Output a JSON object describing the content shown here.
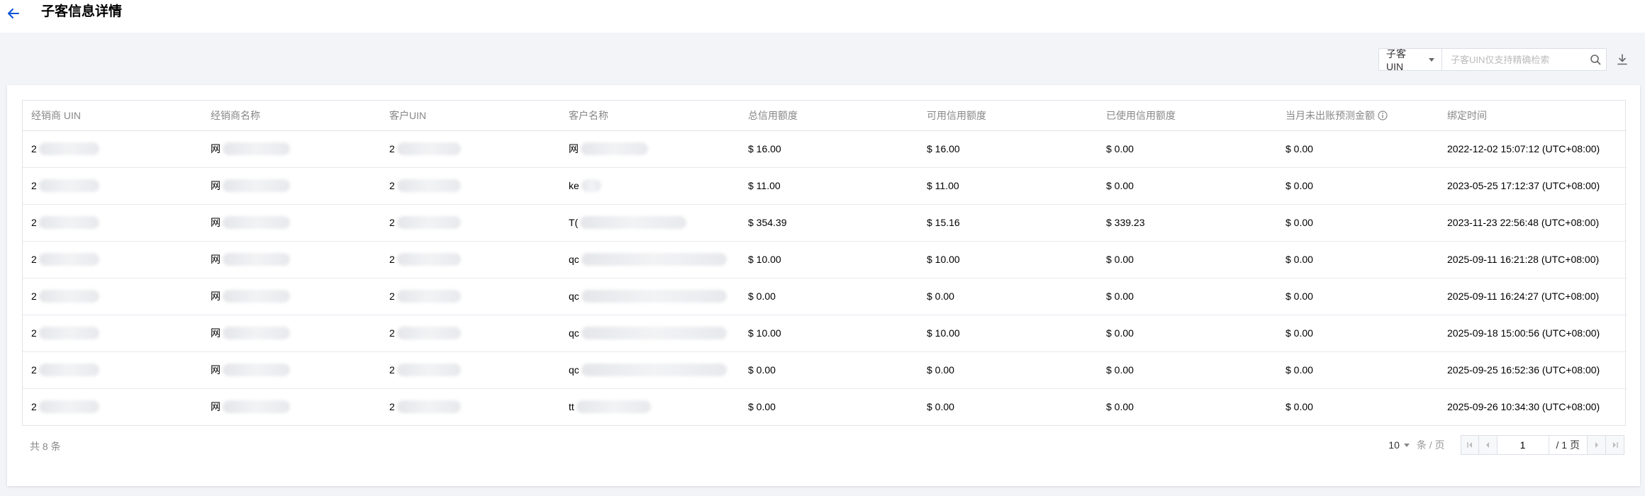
{
  "header": {
    "title": "子客信息详情",
    "back_icon": "arrow-left-icon",
    "accent": "#0052d9"
  },
  "toolbar": {
    "filter_label": "子客 UIN",
    "search_placeholder": "子客UIN仅支持精确检索",
    "search_icon": "search-icon",
    "download_icon": "download-icon"
  },
  "table": {
    "columns": [
      "经销商 UIN",
      "经销商名称",
      "客户UIN",
      "客户名称",
      "总信用额度",
      "可用信用额度",
      "已使用信用额度",
      "当月未出账预测金额",
      "绑定时间"
    ],
    "rows": [
      {
        "dealer_uin": "2",
        "dealer_name": "网",
        "customer_uin": "2",
        "customer_name": "网",
        "total_credit": "$ 16.00",
        "available_credit": "$ 16.00",
        "used_credit": "$ 0.00",
        "forecast": "$ 0.00",
        "bind_time": "2022-12-02 15:07:12 (UTC+08:00)"
      },
      {
        "dealer_uin": "2",
        "dealer_name": "网",
        "customer_uin": "2",
        "customer_name": "ke",
        "total_credit": "$ 11.00",
        "available_credit": "$ 11.00",
        "used_credit": "$ 0.00",
        "forecast": "$ 0.00",
        "bind_time": "2023-05-25 17:12:37 (UTC+08:00)"
      },
      {
        "dealer_uin": "2",
        "dealer_name": "网",
        "customer_uin": "2",
        "customer_name": "T(",
        "total_credit": "$ 354.39",
        "available_credit": "$ 15.16",
        "used_credit": "$ 339.23",
        "forecast": "$ 0.00",
        "bind_time": "2023-11-23 22:56:48 (UTC+08:00)"
      },
      {
        "dealer_uin": "2",
        "dealer_name": "网",
        "customer_uin": "2",
        "customer_name": "qc",
        "total_credit": "$ 10.00",
        "available_credit": "$ 10.00",
        "used_credit": "$ 0.00",
        "forecast": "$ 0.00",
        "bind_time": "2025-09-11 16:21:28 (UTC+08:00)"
      },
      {
        "dealer_uin": "2",
        "dealer_name": "网",
        "customer_uin": "2",
        "customer_name": "qc",
        "total_credit": "$ 0.00",
        "available_credit": "$ 0.00",
        "used_credit": "$ 0.00",
        "forecast": "$ 0.00",
        "bind_time": "2025-09-11 16:24:27 (UTC+08:00)"
      },
      {
        "dealer_uin": "2",
        "dealer_name": "网",
        "customer_uin": "2",
        "customer_name": "qc",
        "total_credit": "$ 10.00",
        "available_credit": "$ 10.00",
        "used_credit": "$ 0.00",
        "forecast": "$ 0.00",
        "bind_time": "2025-09-18 15:00:56 (UTC+08:00)"
      },
      {
        "dealer_uin": "2",
        "dealer_name": "网",
        "customer_uin": "2",
        "customer_name": "qc",
        "total_credit": "$ 0.00",
        "available_credit": "$ 0.00",
        "used_credit": "$ 0.00",
        "forecast": "$ 0.00",
        "bind_time": "2025-09-25 16:52:36 (UTC+08:00)"
      },
      {
        "dealer_uin": "2",
        "dealer_name": "网",
        "customer_uin": "2",
        "customer_name": "tt",
        "total_credit": "$ 0.00",
        "available_credit": "$ 0.00",
        "used_credit": "$ 0.00",
        "forecast": "$ 0.00",
        "bind_time": "2025-09-26 10:34:30 (UTC+08:00)"
      }
    ]
  },
  "footer": {
    "total_text": "共 8 条",
    "page_size": "10",
    "per_page_label": "条 / 页",
    "current_page": "1",
    "total_pages": "/ 1 页"
  }
}
